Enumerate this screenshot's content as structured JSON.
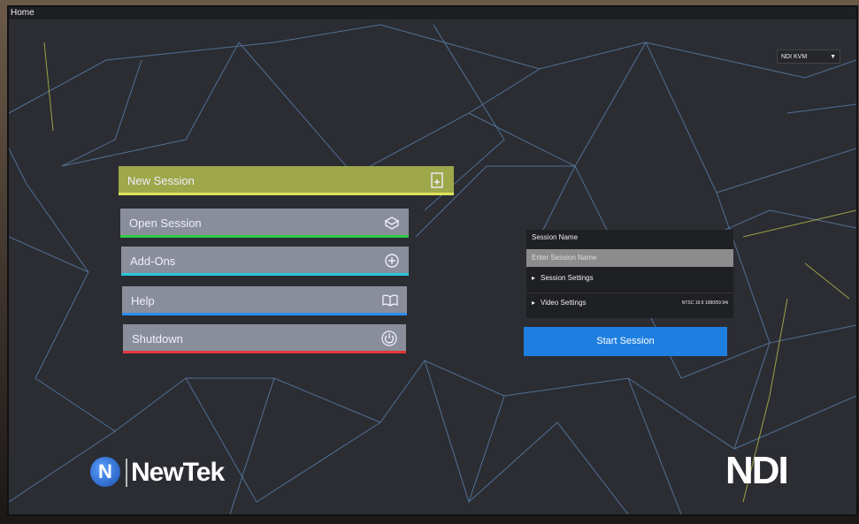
{
  "window": {
    "title": "Home"
  },
  "source_select": {
    "value": "NDI KVM",
    "chevron_icon": "chevron-down-icon"
  },
  "menu": [
    {
      "id": "new",
      "label": "New Session",
      "icon": "new-document-icon",
      "accent": "#e0e35a"
    },
    {
      "id": "open",
      "label": "Open Session",
      "icon": "open-box-icon",
      "accent": "#2fc94a"
    },
    {
      "id": "addons",
      "label": "Add-Ons",
      "icon": "plus-circle-icon",
      "accent": "#26c7d8"
    },
    {
      "id": "help",
      "label": "Help",
      "icon": "book-icon",
      "accent": "#2c8ef0"
    },
    {
      "id": "shutdown",
      "label": "Shutdown",
      "icon": "power-icon",
      "accent": "#e2363a"
    }
  ],
  "session_panel": {
    "header": "Session Name",
    "name_placeholder": "Enter Session Name",
    "session_settings_label": "Session Settings",
    "video_settings_label": "Video Settings",
    "video_settings_value": "NTSC 16:9 1080/59.94i"
  },
  "start_button": {
    "label": "Start Session",
    "color": "#1e7fe0"
  },
  "logos": {
    "left": "NewTek",
    "right": "NDI"
  }
}
